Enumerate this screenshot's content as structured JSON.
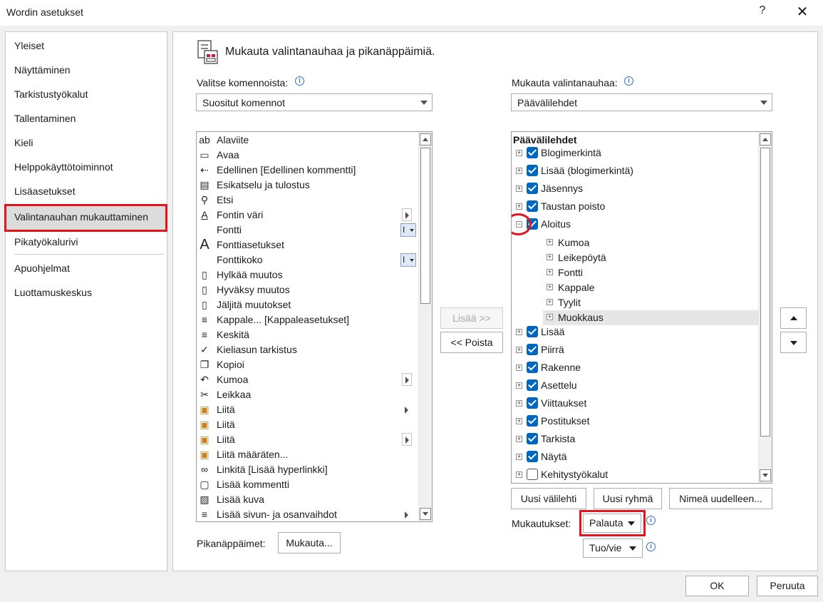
{
  "window": {
    "title": "Wordin asetukset",
    "help_label": "?",
    "close_label": "✕"
  },
  "nav": {
    "items": [
      "Yleiset",
      "Näyttäminen",
      "Tarkistustyökalut",
      "Tallentaminen",
      "Kieli",
      "Helppokäyttötoiminnot",
      "Lisäasetukset",
      "Valintanauhan mukauttaminen",
      "Pikatyökalurivi",
      "Apuohjelmat",
      "Luottamuskeskus"
    ],
    "selected": "Valintanauhan mukauttaminen"
  },
  "header": {
    "title": "Mukauta valintanauhaa ja pikanäppäimiä."
  },
  "left": {
    "choose_label": "Valitse komennoista:",
    "choose_value": "Suositut komennot",
    "commands": [
      {
        "label": "Alaviite",
        "icon": "footnote-icon"
      },
      {
        "label": "Avaa",
        "icon": "folder-open-icon"
      },
      {
        "label": "Edellinen [Edellinen kommentti]",
        "icon": "previous-comment-icon"
      },
      {
        "label": "Esikatselu ja tulostus",
        "icon": "print-preview-icon"
      },
      {
        "label": "Etsi",
        "icon": "search-icon"
      },
      {
        "label": "Fontin väri",
        "icon": "font-color-icon"
      },
      {
        "label": "Fontti",
        "icon": ""
      },
      {
        "label": "Fonttiasetukset",
        "icon": "font-settings-icon"
      },
      {
        "label": "Fonttikoko",
        "icon": ""
      },
      {
        "label": "Hylkää muutos",
        "icon": "reject-change-icon"
      },
      {
        "label": "Hyväksy muutos",
        "icon": "accept-change-icon"
      },
      {
        "label": "Jäljitä muutokset",
        "icon": "track-changes-icon"
      },
      {
        "label": "Kappale... [Kappaleasetukset]",
        "icon": "paragraph-settings-icon"
      },
      {
        "label": "Keskitä",
        "icon": "align-center-icon"
      },
      {
        "label": "Kieliasun tarkistus",
        "icon": "spelling-check-icon"
      },
      {
        "label": "Kopioi",
        "icon": "copy-icon"
      },
      {
        "label": "Kumoa",
        "icon": "undo-icon"
      },
      {
        "label": "Leikkaa",
        "icon": "cut-icon"
      },
      {
        "label": "Liitä",
        "icon": "paste-icon"
      },
      {
        "label": "Liitä",
        "icon": "paste-icon"
      },
      {
        "label": "Liitä",
        "icon": "paste-icon"
      },
      {
        "label": "Liitä määräten...",
        "icon": "paste-special-icon"
      },
      {
        "label": "Linkitä [Lisää hyperlinkki]",
        "icon": "link-icon"
      },
      {
        "label": "Lisää kommentti",
        "icon": "new-comment-icon"
      },
      {
        "label": "Lisää kuva",
        "icon": "insert-picture-icon"
      },
      {
        "label": "Lisää sivun- ja osanvaihdot",
        "icon": "page-break-icon"
      }
    ],
    "shortcuts_label": "Pikanäppäimet:",
    "shortcuts_button": "Mukauta..."
  },
  "middle": {
    "add_button": "Lisää >>",
    "remove_button": "<< Poista"
  },
  "right": {
    "customize_label": "Mukauta valintanauhaa:",
    "customize_value": "Päävälilehdet",
    "tree_header": "Päävälilehdet",
    "tabs_before": [
      {
        "label": "Blogimerkintä",
        "checked": true
      },
      {
        "label": "Lisää (blogimerkintä)",
        "checked": true
      },
      {
        "label": "Jäsennys",
        "checked": true
      },
      {
        "label": "Taustan poisto",
        "checked": true
      }
    ],
    "expanded_tab": {
      "label": "Aloitus",
      "checked": true
    },
    "groups": [
      "Kumoa",
      "Leikepöytä",
      "Fontti",
      "Kappale",
      "Tyylit",
      "Muokkaus"
    ],
    "selected_group": "Muokkaus",
    "tabs_after": [
      {
        "label": "Lisää",
        "checked": true
      },
      {
        "label": "Piirrä",
        "checked": true
      },
      {
        "label": "Rakenne",
        "checked": true
      },
      {
        "label": "Asettelu",
        "checked": true
      },
      {
        "label": "Viittaukset",
        "checked": true
      },
      {
        "label": "Postitukset",
        "checked": true
      },
      {
        "label": "Tarkista",
        "checked": true
      },
      {
        "label": "Näytä",
        "checked": true
      },
      {
        "label": "Kehitystyökalut",
        "checked": false
      }
    ],
    "new_tab_button": "Uusi välilehti",
    "new_group_button": "Uusi ryhmä",
    "rename_button": "Nimeä uudelleen...",
    "customizations_label": "Mukautukset:",
    "reset_button": "Palauta",
    "import_export_button": "Tuo/vie"
  },
  "footer": {
    "ok_button": "OK",
    "cancel_button": "Peruuta"
  },
  "colors": {
    "highlight": "#e5131d",
    "checkbox": "#0067c0",
    "info": "#2b6fc4"
  }
}
